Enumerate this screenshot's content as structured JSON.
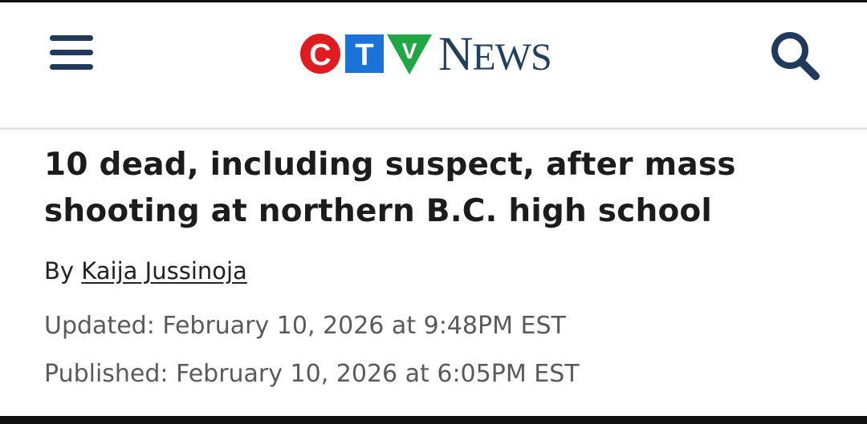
{
  "header": {
    "menu_icon": "hamburger-menu-icon",
    "logo": {
      "letters": [
        "C",
        "T",
        "V"
      ],
      "wordmark_first": "N",
      "wordmark_rest": "EWS",
      "colors": {
        "c_red": "#e11b22",
        "t_blue": "#1a73d9",
        "v_green": "#21a645",
        "wordmark": "#24405f"
      }
    },
    "search_icon": "magnifying-glass-icon"
  },
  "article": {
    "headline": "10 dead, including suspect, after mass shooting at northern B.C. high school",
    "byline_prefix": "By",
    "author": "Kaija Jussinoja",
    "updated": "Updated: February 10, 2026 at 9:48PM EST",
    "published": "Published: February 10, 2026 at 6:05PM EST"
  }
}
